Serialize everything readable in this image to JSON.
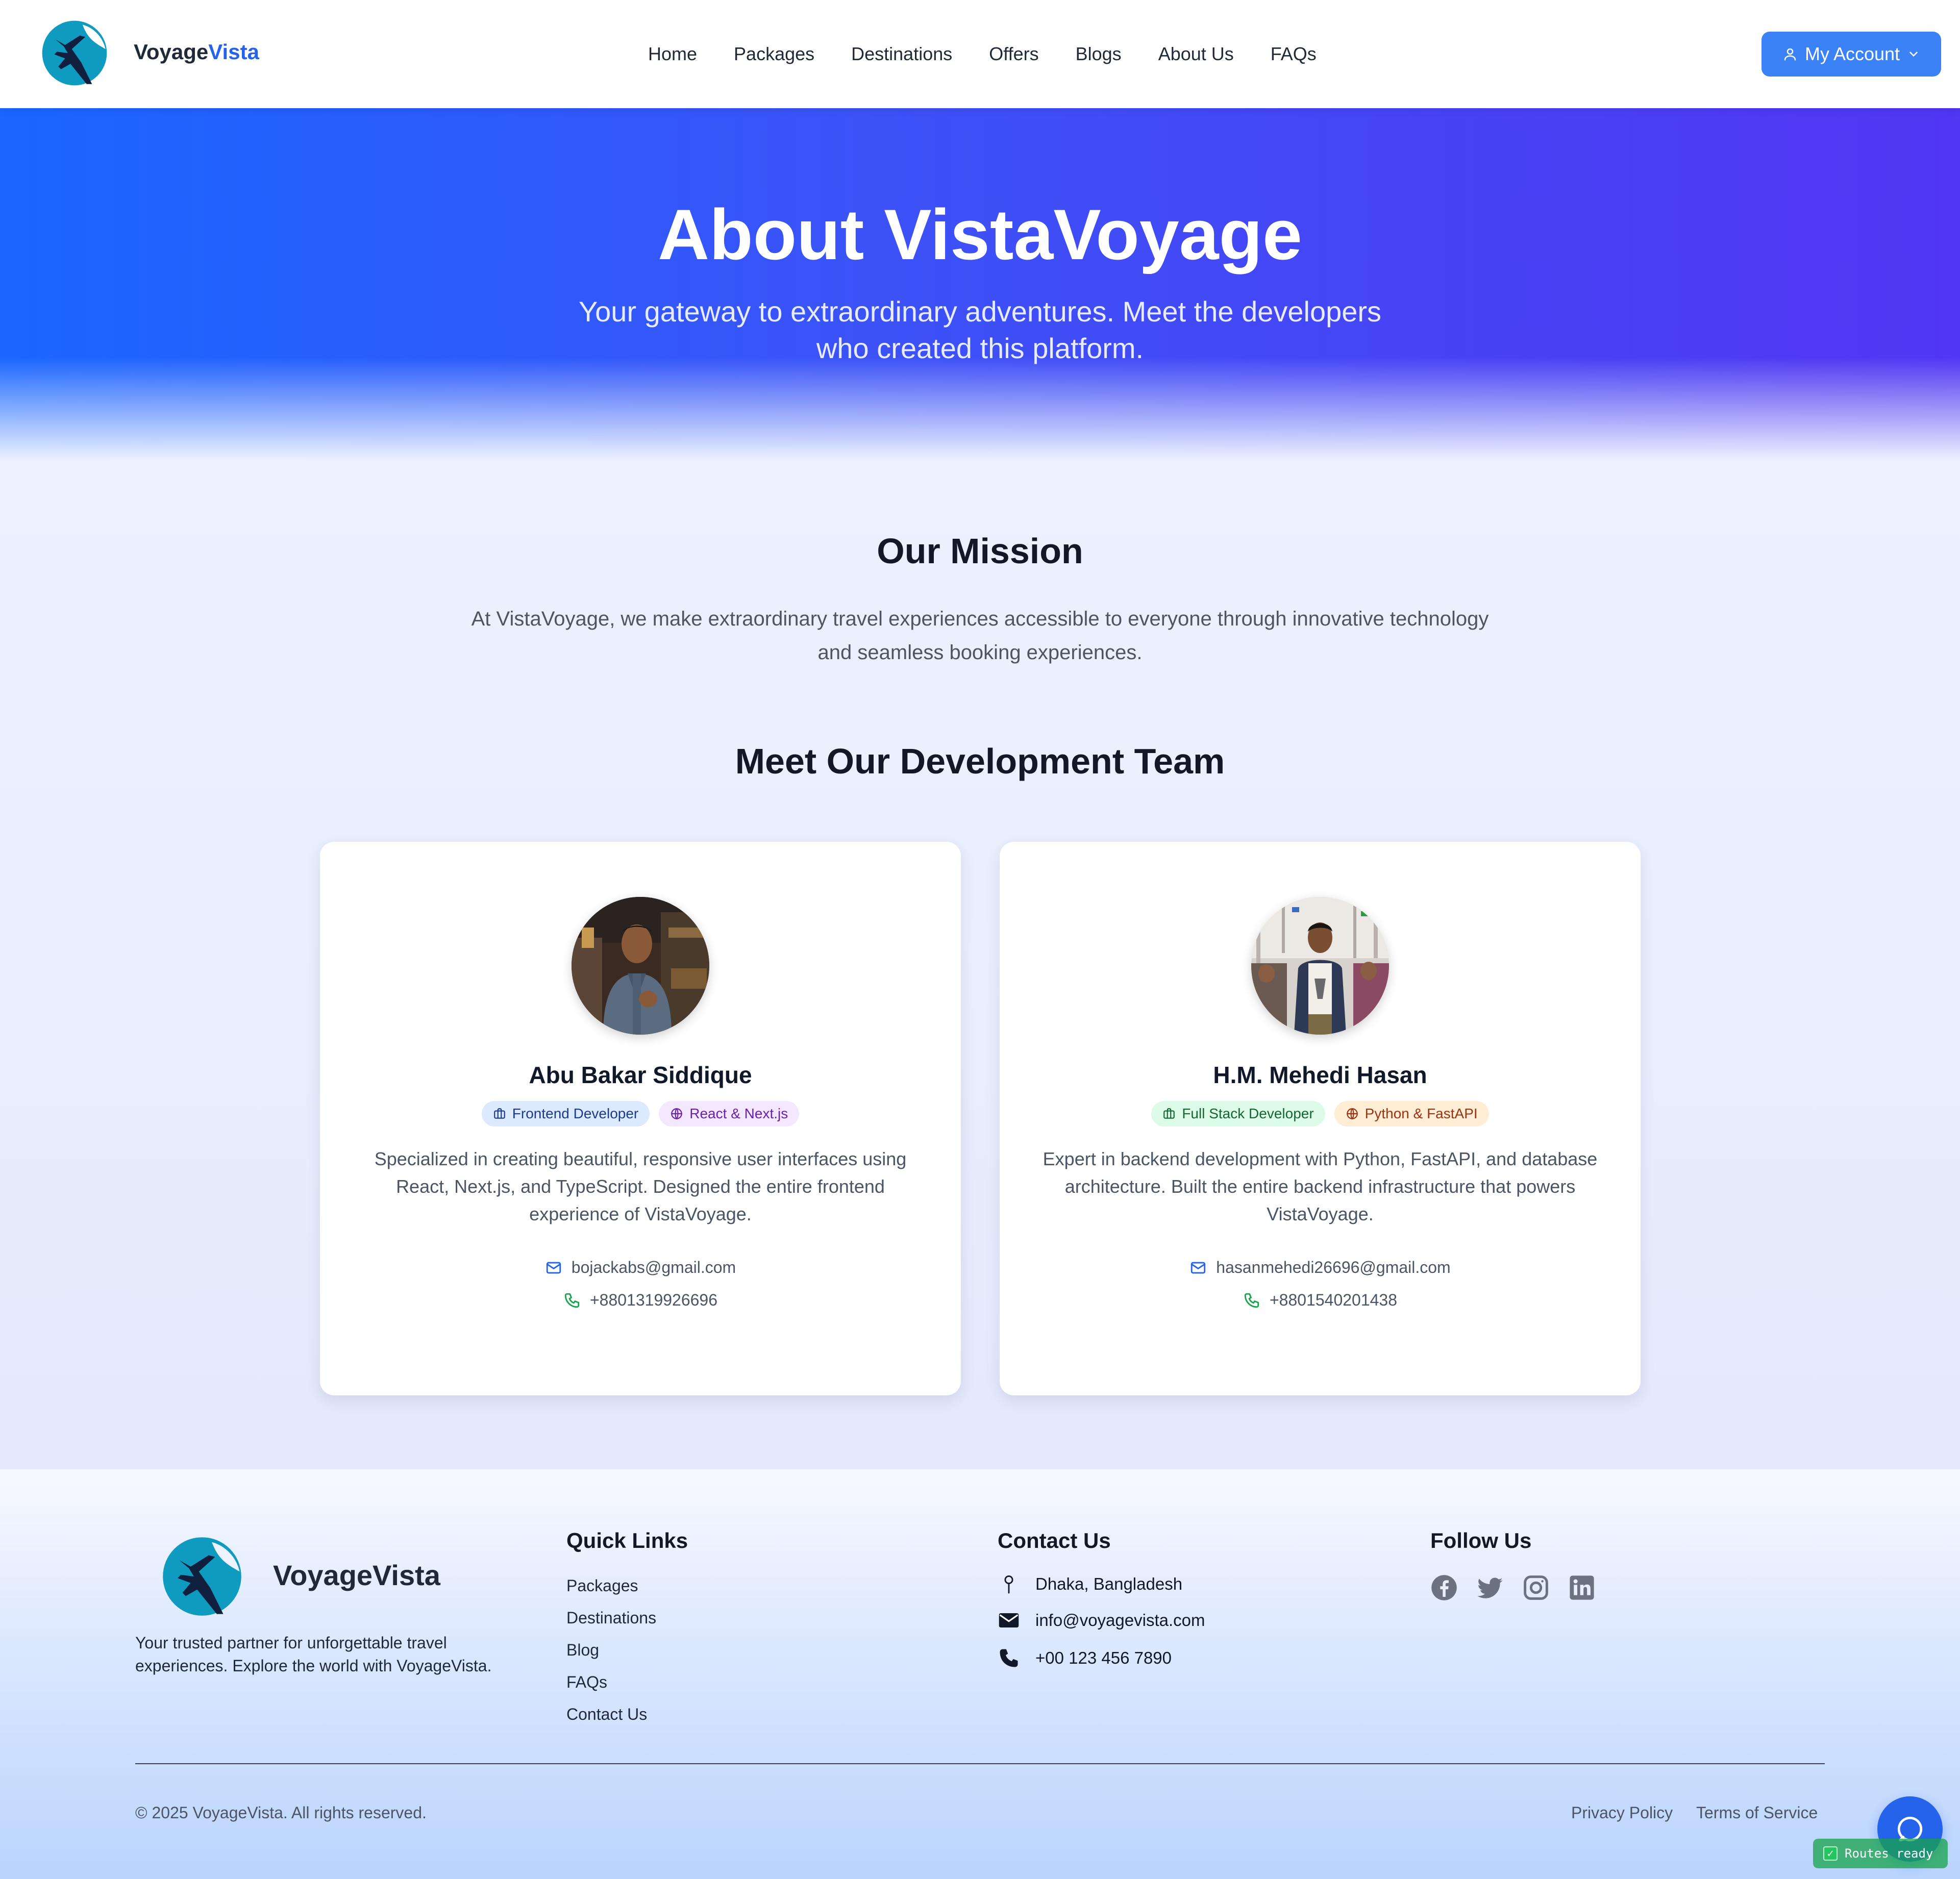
{
  "nav": {
    "brand_part1": "Voyage",
    "brand_part2": "Vista",
    "links": [
      "Home",
      "Packages",
      "Destinations",
      "Offers",
      "Blogs",
      "About Us",
      "FAQs"
    ],
    "account_label": "My Account"
  },
  "hero": {
    "title": "About VistaVoyage",
    "subtitle": "Your gateway to extraordinary adventures. Meet the developers who created this platform."
  },
  "mission": {
    "title": "Our Mission",
    "text": "At VistaVoyage, we make extraordinary travel experiences accessible to everyone through innovative technology and seamless booking experiences."
  },
  "team": {
    "title": "Meet Our Development Team",
    "members": [
      {
        "name": "Abu Bakar Siddique",
        "role": "Frontend Developer",
        "stack": "React & Next.js",
        "description": "Specialized in creating beautiful, responsive user interfaces using React, Next.js, and TypeScript. Designed the entire frontend experience of VistaVoyage.",
        "email": "bojackabs@gmail.com",
        "phone": "+8801319926696"
      },
      {
        "name": "H.M. Mehedi Hasan",
        "role": "Full Stack Developer",
        "stack": "Python & FastAPI",
        "description": "Expert in backend development with Python, FastAPI, and database architecture. Built the entire backend infrastructure that powers VistaVoyage.",
        "email": "hasanmehedi26696@gmail.com",
        "phone": "+8801540201438"
      }
    ]
  },
  "footer": {
    "brand": "VoyageVista",
    "tagline": "Your trusted partner for unforgettable travel experiences. Explore the world with VoyageVista.",
    "quick_links_title": "Quick Links",
    "quick_links": [
      "Packages",
      "Destinations",
      "Blog",
      "FAQs",
      "Contact Us"
    ],
    "contact_title": "Contact Us",
    "address": "Dhaka, Bangladesh",
    "email": "info@voyagevista.com",
    "phone": "+00 123 456 7890",
    "follow_title": "Follow Us",
    "socials": [
      "facebook-icon",
      "twitter-icon",
      "instagram-icon",
      "linkedin-icon"
    ],
    "copyright": "© 2025 VoyageVista. All rights reserved.",
    "privacy": "Privacy Policy",
    "terms": "Terms of Service"
  },
  "dev_badge": "Routes ready",
  "colors": {
    "primary": "#2563eb",
    "hero_start": "#1a66ff",
    "hero_end": "#5136f3",
    "email_icon": "#2563eb",
    "phone_icon": "#16a34a"
  }
}
